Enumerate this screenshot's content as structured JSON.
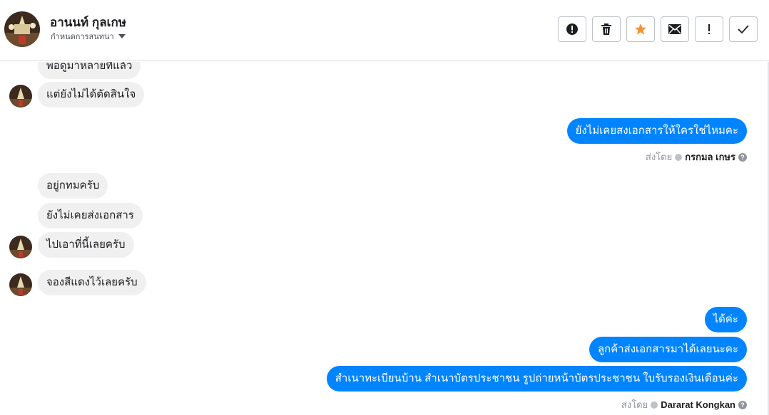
{
  "header": {
    "contact_name": "อานนท์ กุลเกษ",
    "conversation_menu": "กำหนดการสนทนา",
    "actions": [
      {
        "icon": "alert-circle-icon"
      },
      {
        "icon": "trash-icon"
      },
      {
        "icon": "star-icon",
        "color": "#f7923b"
      },
      {
        "icon": "envelope-icon"
      },
      {
        "icon": "exclamation-icon"
      },
      {
        "icon": "checkmark-icon"
      }
    ]
  },
  "messages": {
    "in_1": "พอดูมาหลายทีแล้ว",
    "in_2": "แต่ยังไม่ได้ตัดสินใจ",
    "out_1": "ยังไม่เคยสงเอกสารให้ใครใช่ไหมคะ",
    "sent_by_1": {
      "prefix": "ส่งโดย",
      "name": "กรกมล เกษร"
    },
    "in_3": "อยู่กทมครับ",
    "in_4": "ยังไม่เคยส่งเอกสาร",
    "in_5": "ไปเอาที่นี้เลยครับ",
    "in_6": "จองสีแดงไว้เลยครับ",
    "out_2": "ได้ค่ะ",
    "out_3": "ลูกค้าส่งเอกสารมาได้เลยนะคะ",
    "out_4": "สำเนาทะเบียนบ้าน  สำเนาบัตรประชาชน รูปถ่ายหน้าบัตรประชาชน ใบรับรองเงินเดือนค่ะ",
    "sent_by_2": {
      "prefix": "ส่งโดย",
      "name": "Dararat Kongkan"
    }
  },
  "colors": {
    "outgoing_bubble": "#0084ff",
    "incoming_bubble": "#f0f0f0",
    "star_accent": "#f7923b"
  }
}
